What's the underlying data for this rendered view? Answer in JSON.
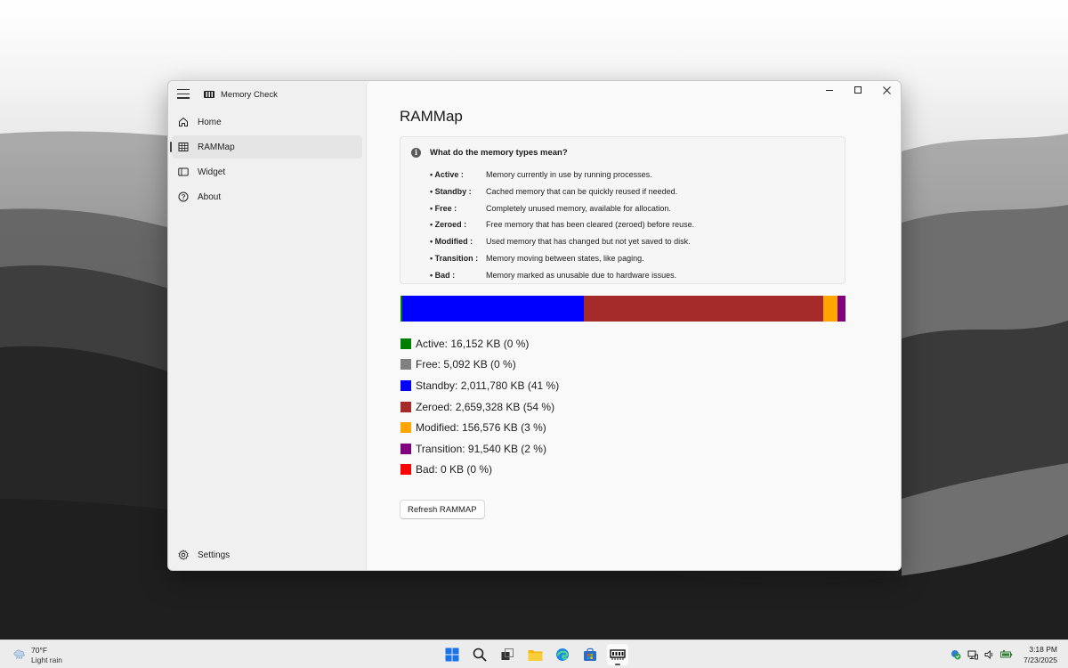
{
  "app": {
    "title": "Memory Check"
  },
  "sidebar": {
    "items": [
      {
        "label": "Home",
        "icon": "home-icon"
      },
      {
        "label": "RAMMap",
        "icon": "grid-icon",
        "active": true
      },
      {
        "label": "Widget",
        "icon": "widget-icon"
      },
      {
        "label": "About",
        "icon": "help-circle-icon"
      }
    ],
    "settings_label": "Settings"
  },
  "main": {
    "title": "RAMMap",
    "info": {
      "heading": "What do the memory types mean?",
      "types": [
        {
          "name": "• Active :",
          "desc": "Memory currently in use by running processes."
        },
        {
          "name": "• Standby :",
          "desc": "Cached memory that can be quickly reused if needed."
        },
        {
          "name": "• Free :",
          "desc": "Completely unused memory, available for allocation."
        },
        {
          "name": "• Zeroed :",
          "desc": "Free memory that has been cleared (zeroed) before reuse."
        },
        {
          "name": "• Modified :",
          "desc": "Used memory that has changed but not yet saved to disk."
        },
        {
          "name": "• Transition :",
          "desc": "Memory moving between states, like paging."
        },
        {
          "name": "• Bad :",
          "desc": "Memory marked as unusable due to hardware issues."
        }
      ]
    },
    "memory_bar": [
      {
        "type": "Active",
        "kb": 16152,
        "color": "#008000"
      },
      {
        "type": "Free",
        "kb": 5092,
        "color": "#808080"
      },
      {
        "type": "Standby",
        "kb": 2011780,
        "color": "#0000ff"
      },
      {
        "type": "Zeroed",
        "kb": 2659328,
        "color": "#a52a2a"
      },
      {
        "type": "Modified",
        "kb": 156576,
        "color": "#ffa500"
      },
      {
        "type": "Transition",
        "kb": 91540,
        "color": "#800080"
      },
      {
        "type": "Bad",
        "kb": 0,
        "color": "#ff0000"
      }
    ],
    "legend": [
      {
        "text": "Active: 16,152 KB (0 %)",
        "color": "#008000"
      },
      {
        "text": "Free: 5,092 KB (0 %)",
        "color": "#808080"
      },
      {
        "text": "Standby: 2,011,780 KB (41 %)",
        "color": "#0000ff"
      },
      {
        "text": "Zeroed: 2,659,328 KB (54 %)",
        "color": "#a52a2a"
      },
      {
        "text": "Modified: 156,576 KB (3 %)",
        "color": "#ffa500"
      },
      {
        "text": "Transition: 91,540 KB (2 %)",
        "color": "#800080"
      },
      {
        "text": "Bad: 0 KB (0 %)",
        "color": "#ff0000"
      }
    ],
    "refresh_label": "Refresh RAMMAP"
  },
  "taskbar": {
    "weather_temp": "70°F",
    "weather_desc": "Light rain",
    "apps": [
      "windows-start-icon",
      "search-icon",
      "task-view-icon",
      "file-explorer-icon",
      "edge-browser-icon",
      "microsoft-store-icon",
      "memory-check-app-icon"
    ],
    "time": "3:18 PM",
    "date": "7/23/2025"
  }
}
